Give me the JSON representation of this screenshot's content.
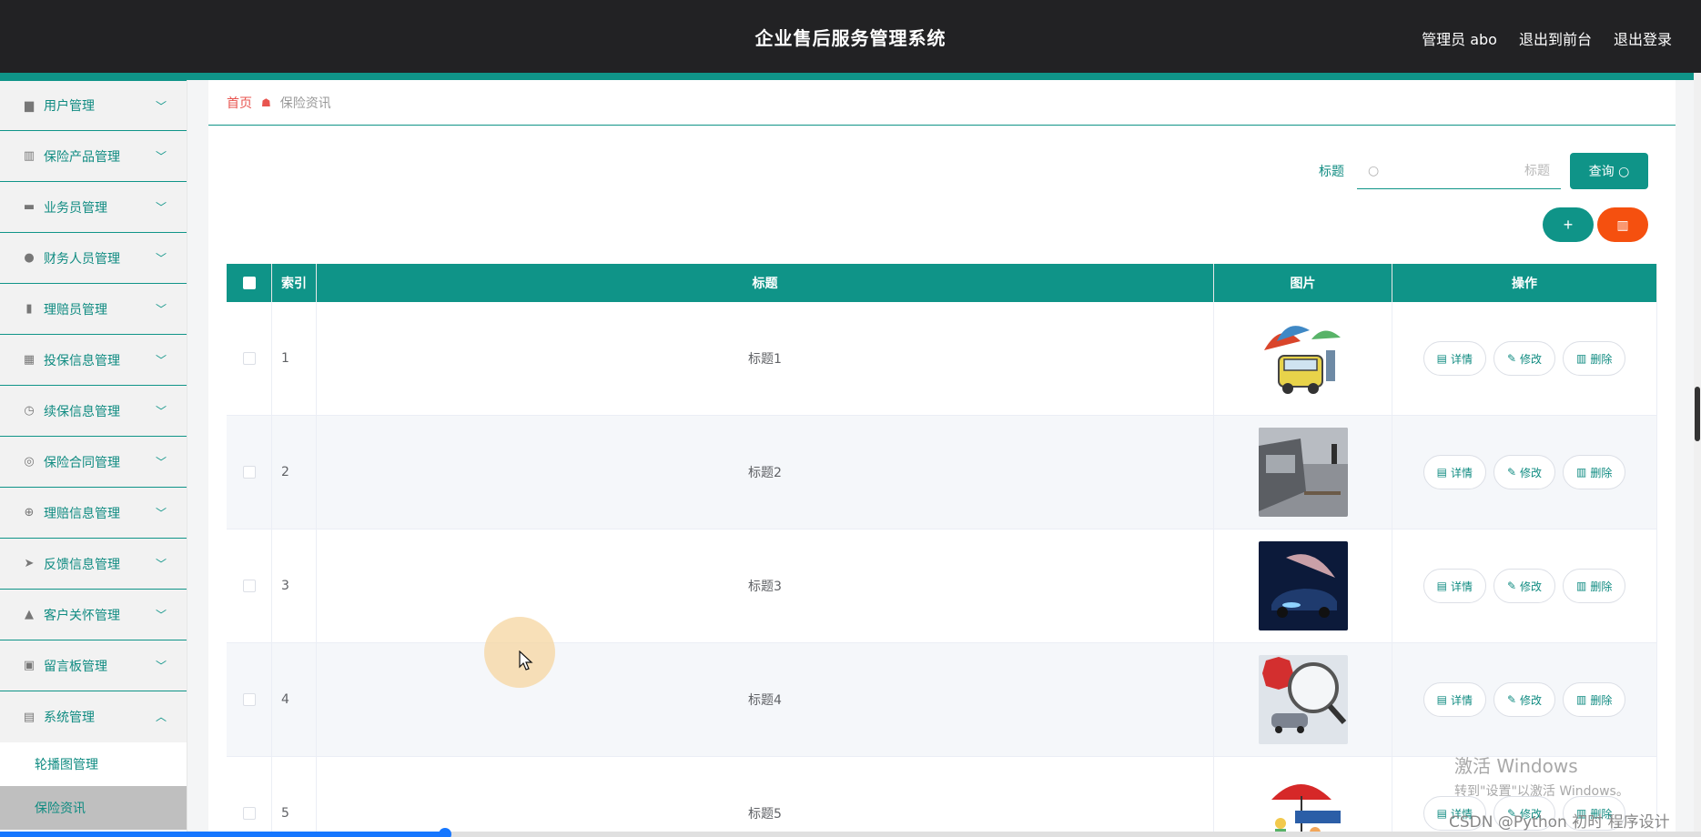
{
  "header": {
    "title": "企业售后服务管理系统",
    "admin": "管理员 abo",
    "to_front": "退出到前台",
    "logout": "退出登录"
  },
  "sidebar": {
    "items": [
      {
        "label": "用户管理",
        "icon": "user-desk-icon"
      },
      {
        "label": "保险产品管理",
        "icon": "books-icon"
      },
      {
        "label": "业务员管理",
        "icon": "monitor-icon"
      },
      {
        "label": "财务人员管理",
        "icon": "person-icon"
      },
      {
        "label": "理赔员管理",
        "icon": "bar-chart-icon"
      },
      {
        "label": "投保信息管理",
        "icon": "grid-icon"
      },
      {
        "label": "续保信息管理",
        "icon": "clock-icon"
      },
      {
        "label": "保险合同管理",
        "icon": "ring-icon"
      },
      {
        "label": "理赔信息管理",
        "icon": "crosshair-icon"
      },
      {
        "label": "反馈信息管理",
        "icon": "send-icon"
      },
      {
        "label": "客户关怀管理",
        "icon": "person-card-icon"
      },
      {
        "label": "留言板管理",
        "icon": "briefcase-icon"
      },
      {
        "label": "系统管理",
        "icon": "clipboard-icon"
      }
    ],
    "sub_items": [
      "轮播图管理",
      "保险资讯"
    ]
  },
  "breadcrumb": {
    "home": "首页",
    "current": "保险资讯"
  },
  "search": {
    "label": "标题",
    "placeholder": "标题",
    "button": "查询"
  },
  "table": {
    "headers": {
      "index": "索引",
      "title": "标题",
      "image": "图片",
      "ops": "操作"
    },
    "rows": [
      {
        "index": "1",
        "title": "标题1"
      },
      {
        "index": "2",
        "title": "标题2"
      },
      {
        "index": "3",
        "title": "标题3"
      },
      {
        "index": "4",
        "title": "标题4"
      },
      {
        "index": "5",
        "title": "标题5"
      }
    ],
    "op_labels": {
      "detail": "详情",
      "edit": "修改",
      "delete": "删除"
    }
  },
  "watermarks": {
    "windows_line1": "激活 Windows",
    "windows_line2": "转到\"设置\"以激活 Windows。",
    "csdn": "CSDN @Python 初时 程序设计"
  },
  "colors": {
    "accent": "#0f9488",
    "danger": "#f5500f",
    "header_bg": "#222224"
  }
}
